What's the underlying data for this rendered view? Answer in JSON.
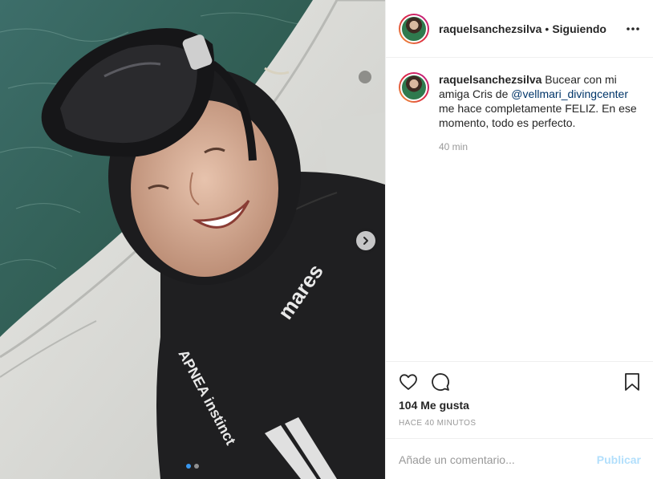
{
  "post": {
    "username": "raquelsanchezsilva",
    "separator": "•",
    "follow_status": "Siguiendo",
    "more_icon": "more-horizontal-icon"
  },
  "caption": {
    "username": "raquelsanchezsilva",
    "text_before": " Bucear con mi amiga Cris de ",
    "mention": "@vellmari_divingcenter",
    "text_after": " me hace completamente FELIZ. En ese momento, todo es perfecto.",
    "time": "40 min"
  },
  "actions": {
    "like_icon": "heart-icon",
    "comment_icon": "comment-icon",
    "save_icon": "bookmark-icon",
    "likes": "104 Me gusta",
    "posted_ago": "HACE 40 MINUTOS"
  },
  "comment_input": {
    "placeholder": "Añade un comentario...",
    "publish_label": "Publicar"
  },
  "media": {
    "next_icon": "chevron-right-icon",
    "carousel_count": 2,
    "active_index": 0,
    "wetsuit_brand_text": "mares",
    "wetsuit_sleeve_text": "APNEA instinct"
  },
  "colors": {
    "accent": "#3897f0",
    "mention": "#003569",
    "publish_disabled": "#b2dffc",
    "muted": "#999999",
    "divider": "#efefef"
  }
}
